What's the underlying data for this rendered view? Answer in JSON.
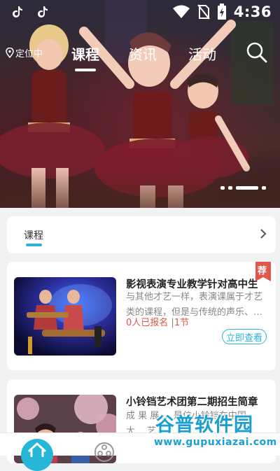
{
  "status_bar": {
    "time": "4:36",
    "icons": [
      "tiktok-icon",
      "tiktok-icon",
      "wifi-icon",
      "no-sim-icon",
      "battery-charging-icon"
    ]
  },
  "top_nav": {
    "location": "定位中",
    "tabs": [
      {
        "label": "课程",
        "active": true
      },
      {
        "label": "资讯",
        "active": false
      },
      {
        "label": "活动",
        "active": false
      }
    ]
  },
  "banner": {
    "slides": 3,
    "active_index": 2
  },
  "section": {
    "title": "课程"
  },
  "courses": [
    {
      "title": "影视表演专业教学针对高中生",
      "desc_line1": "与其他才艺一样，表演课属于才艺",
      "desc_line2": "类的课程，但是与传统的声乐、舞蹈",
      "enrolled": "0人已报名",
      "sep": "|",
      "lessons": "1节",
      "button": "立即查看",
      "badge": "荐"
    },
    {
      "title": "小铃铛艺术团第二期招生简章",
      "desc_line1": "成 果 展 ... 是位小铃铛在中国",
      "desc_line2": "大… 艺… …"
    }
  ],
  "watermark": {
    "name": "谷普软件园",
    "url": "www.gupuxiazai.com"
  },
  "colors": {
    "accent": "#2bb3d6",
    "badge": "#e2574c",
    "home": "#26b7d8"
  }
}
